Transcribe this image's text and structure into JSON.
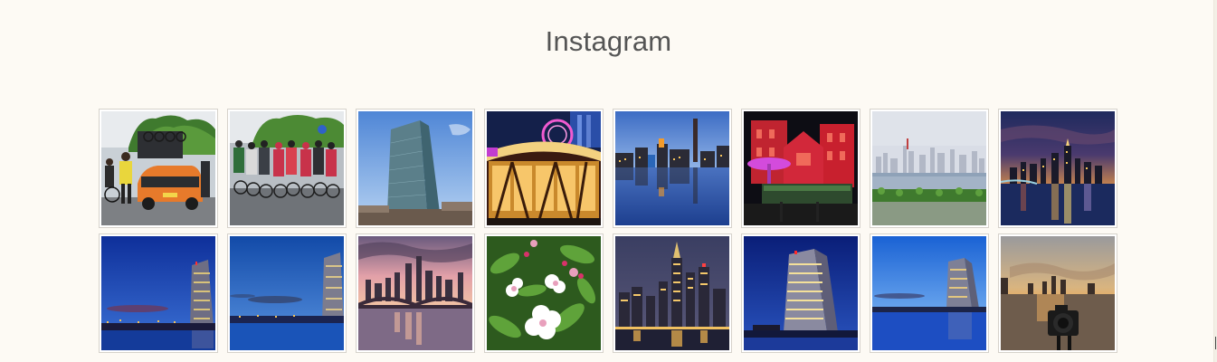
{
  "section": {
    "title": "Instagram"
  },
  "instagram": {
    "photos": [
      {
        "subject": "cycling-race-car"
      },
      {
        "subject": "cycling-peloton"
      },
      {
        "subject": "ecb-tower-day"
      },
      {
        "subject": "illuminated-pavilion-ferris-wheel"
      },
      {
        "subject": "industrial-river-reflection-dusk"
      },
      {
        "subject": "red-lit-brick-building"
      },
      {
        "subject": "skyline-beyond-field"
      },
      {
        "subject": "skyline-night-river"
      },
      {
        "subject": "ecb-tower-blue-hour"
      },
      {
        "subject": "ecb-tower-blue-hour-wide"
      },
      {
        "subject": "skyline-bridge-pink-sunset"
      },
      {
        "subject": "apple-blossoms"
      },
      {
        "subject": "skyline-night-highrises"
      },
      {
        "subject": "ecb-tower-night-closeup"
      },
      {
        "subject": "ecb-tower-river-evening"
      },
      {
        "subject": "camera-silhouette-sunset"
      }
    ]
  },
  "colors": {
    "background": "#fdfaf4",
    "title": "#555555",
    "thumb_border": "#d6d2cb"
  }
}
